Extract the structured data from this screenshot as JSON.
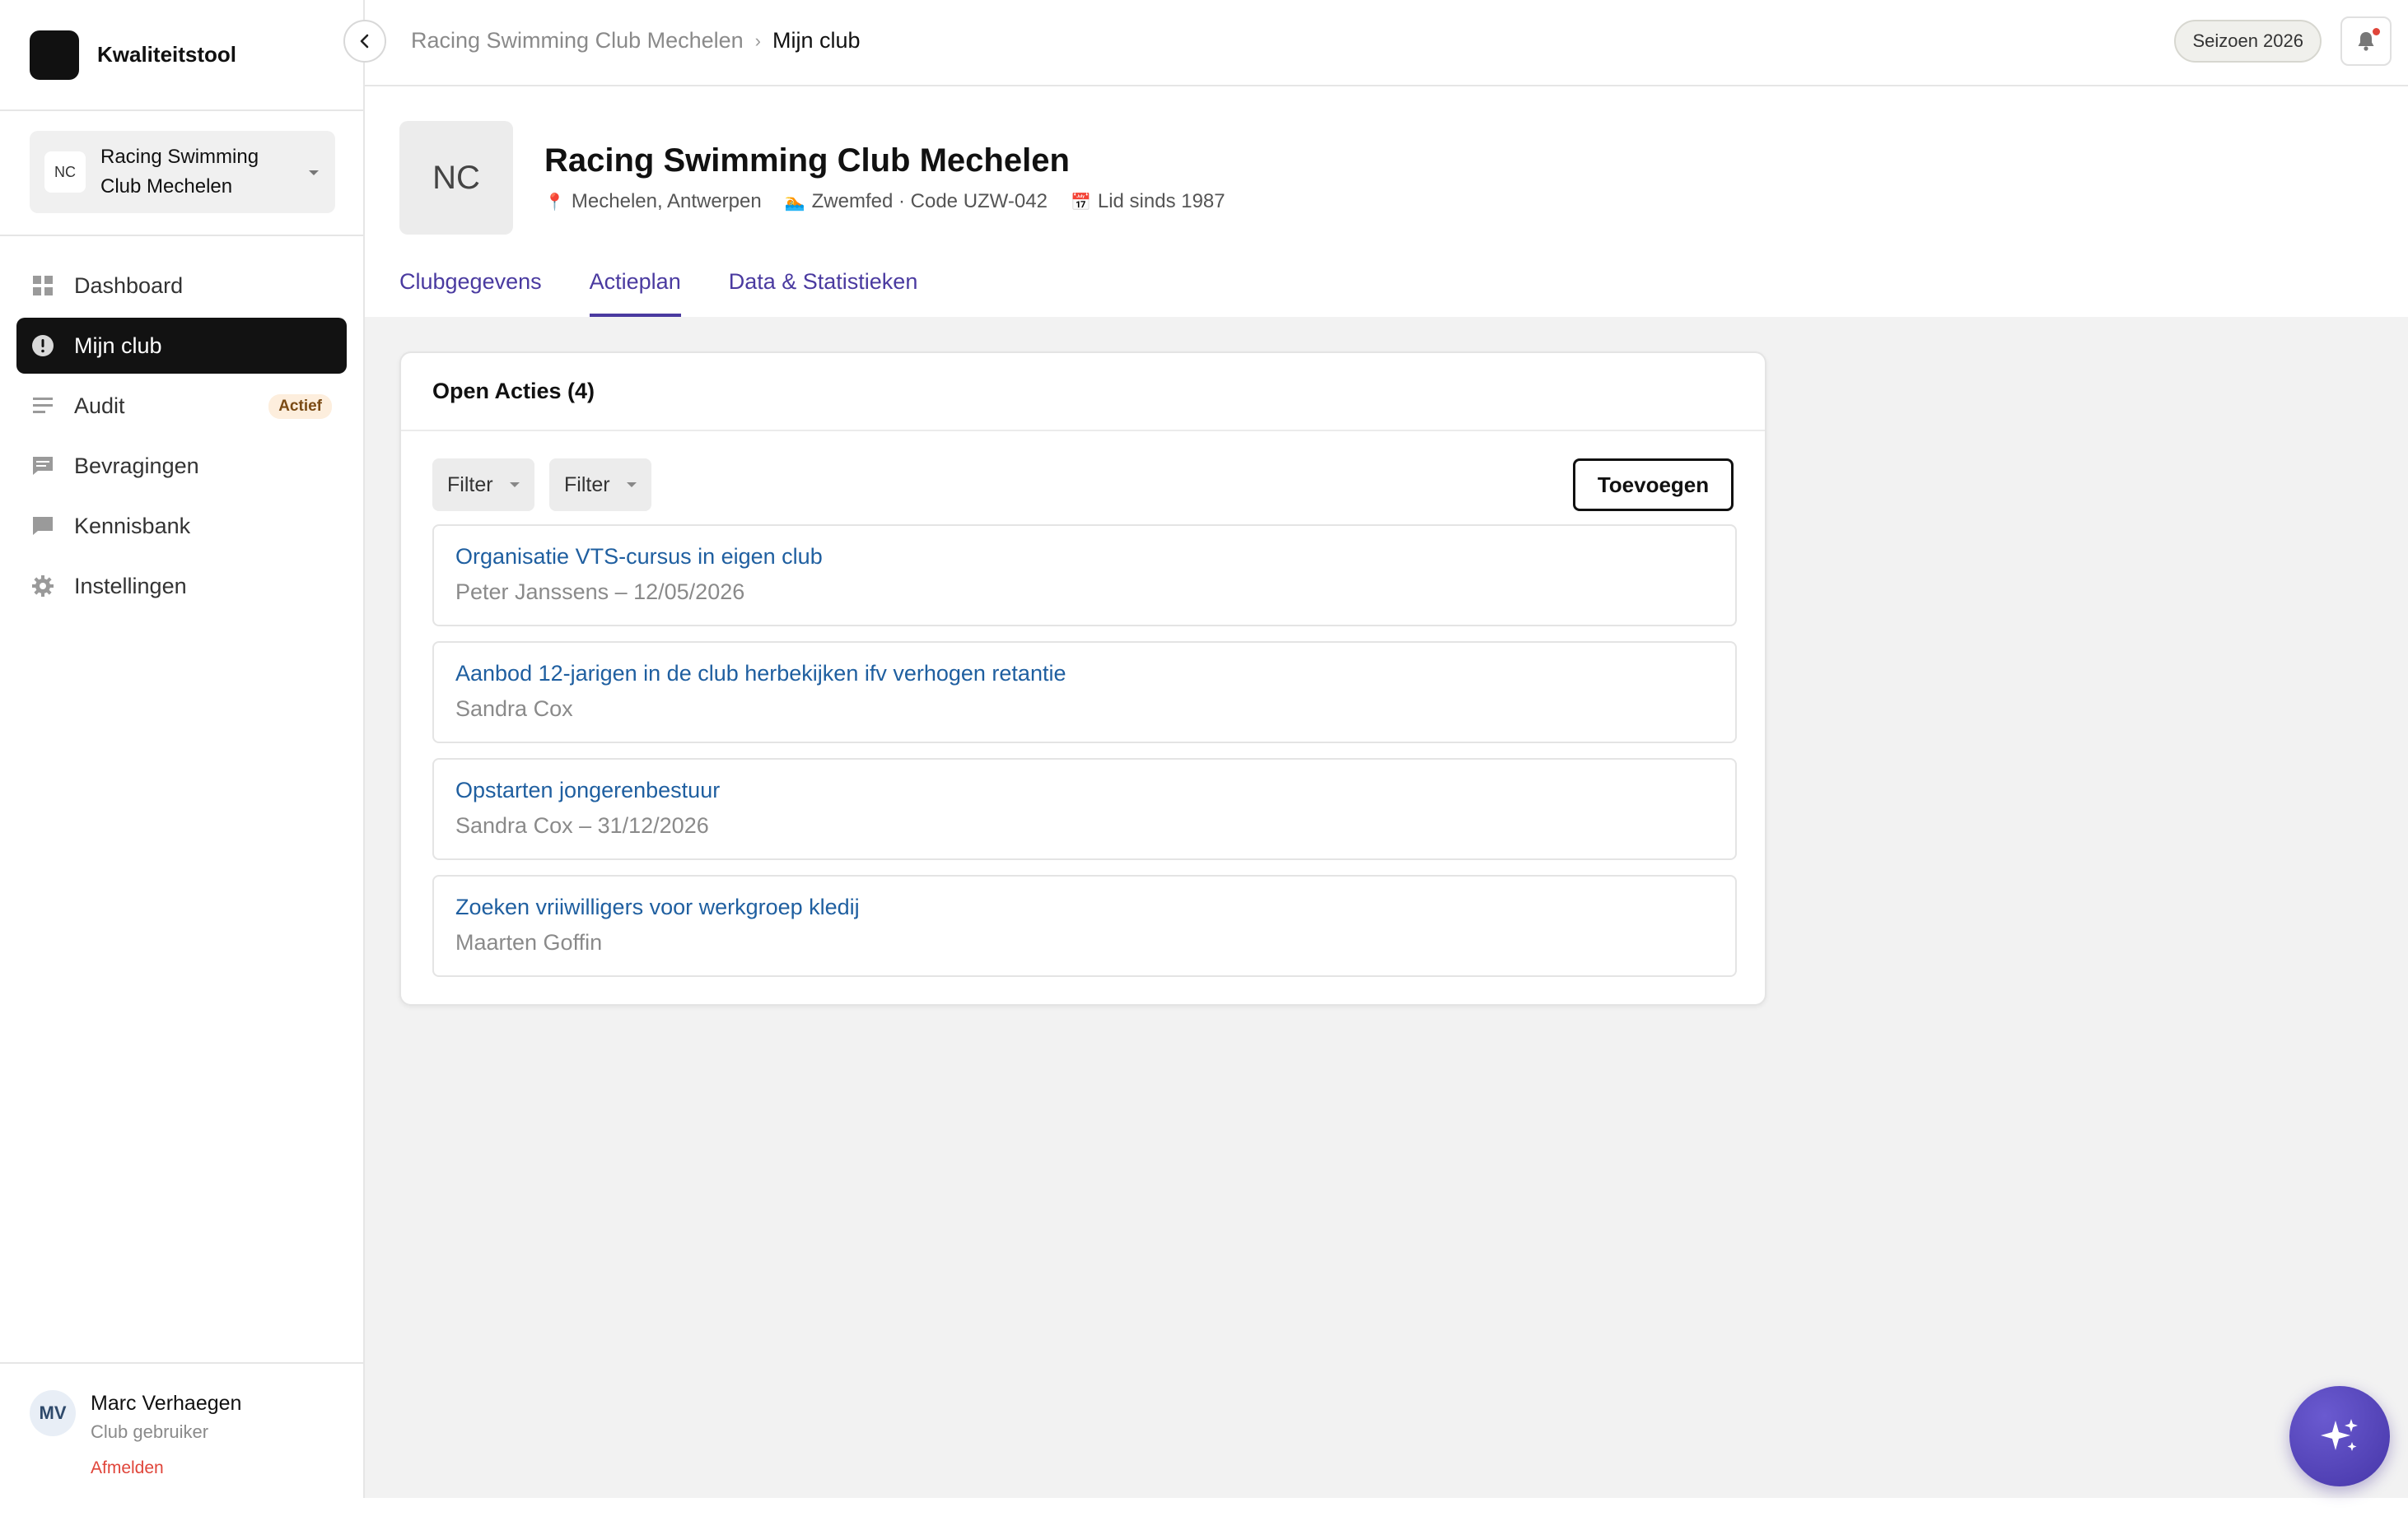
{
  "app": {
    "name": "Kwaliteitstool"
  },
  "club_selector": {
    "initials": "NC",
    "name": "Racing Swimming Club Mechelen"
  },
  "nav": {
    "items": [
      {
        "label": "Dashboard",
        "icon": "grid-icon"
      },
      {
        "label": "Mijn club",
        "icon": "alert-circle-icon",
        "active": true
      },
      {
        "label": "Audit",
        "icon": "list-icon",
        "badge": "Actief"
      },
      {
        "label": "Bevragingen",
        "icon": "chat-icon"
      },
      {
        "label": "Kennisbank",
        "icon": "comment-icon"
      },
      {
        "label": "Instellingen",
        "icon": "gear-icon"
      }
    ]
  },
  "user": {
    "initials": "MV",
    "name": "Marc Verhaegen",
    "role": "Club gebruiker",
    "logout": "Afmelden"
  },
  "breadcrumb": {
    "parent": "Racing Swimming Club Mechelen",
    "separator": "›",
    "current": "Mijn club"
  },
  "season": {
    "label": "Seizoen 2026"
  },
  "club": {
    "initials": "NC",
    "name": "Racing Swimming Club Mechelen",
    "location": "Mechelen, Antwerpen",
    "federation": "Zwemfed · Code UZW-042",
    "since": "Lid sinds 1987"
  },
  "tabs": [
    {
      "label": "Clubgegevens"
    },
    {
      "label": "Actieplan",
      "active": true
    },
    {
      "label": "Data & Statistieken"
    }
  ],
  "actions_card": {
    "title": "Open Acties (4)",
    "filter_1": "Filter",
    "filter_2": "Filter",
    "add_label": "Toevoegen",
    "items": [
      {
        "title": "Organisatie VTS-cursus in eigen club",
        "subtitle": "Peter Janssens – 12/05/2026"
      },
      {
        "title": "Aanbod 12-jarigen in de club herbekijken ifv verhogen retantie",
        "subtitle": "Sandra Cox"
      },
      {
        "title": "Opstarten jongerenbestuur",
        "subtitle": "Sandra Cox – 31/12/2026"
      },
      {
        "title": "Zoeken vriiwilligers voor werkgroep kledij",
        "subtitle": "Maarten Goffin"
      }
    ]
  },
  "colors": {
    "accent": "#4a3aa0",
    "link": "#1f5fa0",
    "active_nav": "#121212",
    "danger": "#e0453a",
    "badge_bg": "#fdeedd"
  }
}
